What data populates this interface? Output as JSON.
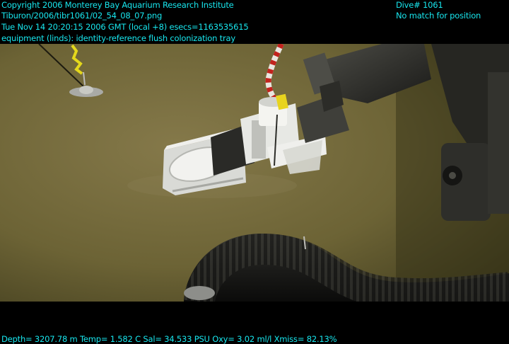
{
  "overlay": {
    "copyright": "Copyright 2006 Monterey Bay Aquarium Research Institute",
    "file_path": "Tiburon/2006/tibr1061/02_54_08_07.png",
    "timestamp": "Tue Nov 14 20:20:15 2006 GMT (local +8)  esecs=1163535615",
    "equipment": "equipment (linds): identity-reference flush colonization tray",
    "dive": "Dive# 1061",
    "position_status": "No match for position",
    "telemetry": "Depth= 3207.78 m  Temp= 1.582 C  Sal= 34.533 PSU  Oxy= 3.02 ml/l  Xmiss= 82.13%"
  },
  "colors": {
    "overlay_text": "#18e6ee",
    "sediment": "#6e6536",
    "letterbox": "#000000"
  }
}
